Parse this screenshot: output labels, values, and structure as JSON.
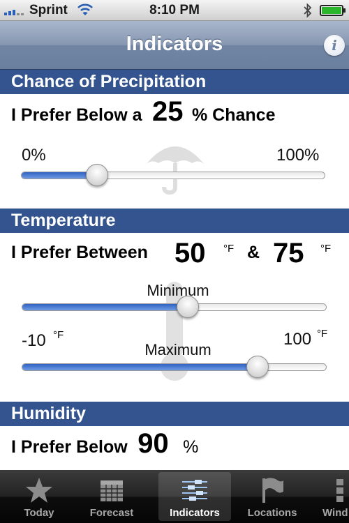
{
  "status_bar": {
    "carrier": "Sprint",
    "time": "8:10 PM"
  },
  "nav": {
    "title": "Indicators",
    "info_label": "i"
  },
  "precipitation": {
    "header": "Chance of Precipitation",
    "prefix": "I Prefer Below a",
    "value": "25",
    "suffix": "% Chance",
    "min_label": "0%",
    "max_label": "100%",
    "slider_fraction": 0.25
  },
  "temperature": {
    "header": "Temperature",
    "prefix": "I Prefer Between",
    "min_value": "50",
    "unit": "°F",
    "connector": "&",
    "max_value": "75",
    "min_caption": "Minimum",
    "max_caption": "Maximum",
    "range_low": "-10",
    "range_high": "100",
    "min_fraction": 0.545,
    "max_fraction": 0.773
  },
  "humidity": {
    "header": "Humidity",
    "prefix": "I Prefer Below",
    "value": "90",
    "suffix": "%"
  },
  "tabs": [
    {
      "label": "Today",
      "icon": "star-icon"
    },
    {
      "label": "Forecast",
      "icon": "calendar-icon"
    },
    {
      "label": "Indicators",
      "icon": "sliders-icon"
    },
    {
      "label": "Locations",
      "icon": "flag-icon"
    },
    {
      "label": "Wind",
      "icon": "more-icon"
    }
  ],
  "colors": {
    "section_header": "#33548f",
    "slider_fill": "#3a6fd0"
  }
}
